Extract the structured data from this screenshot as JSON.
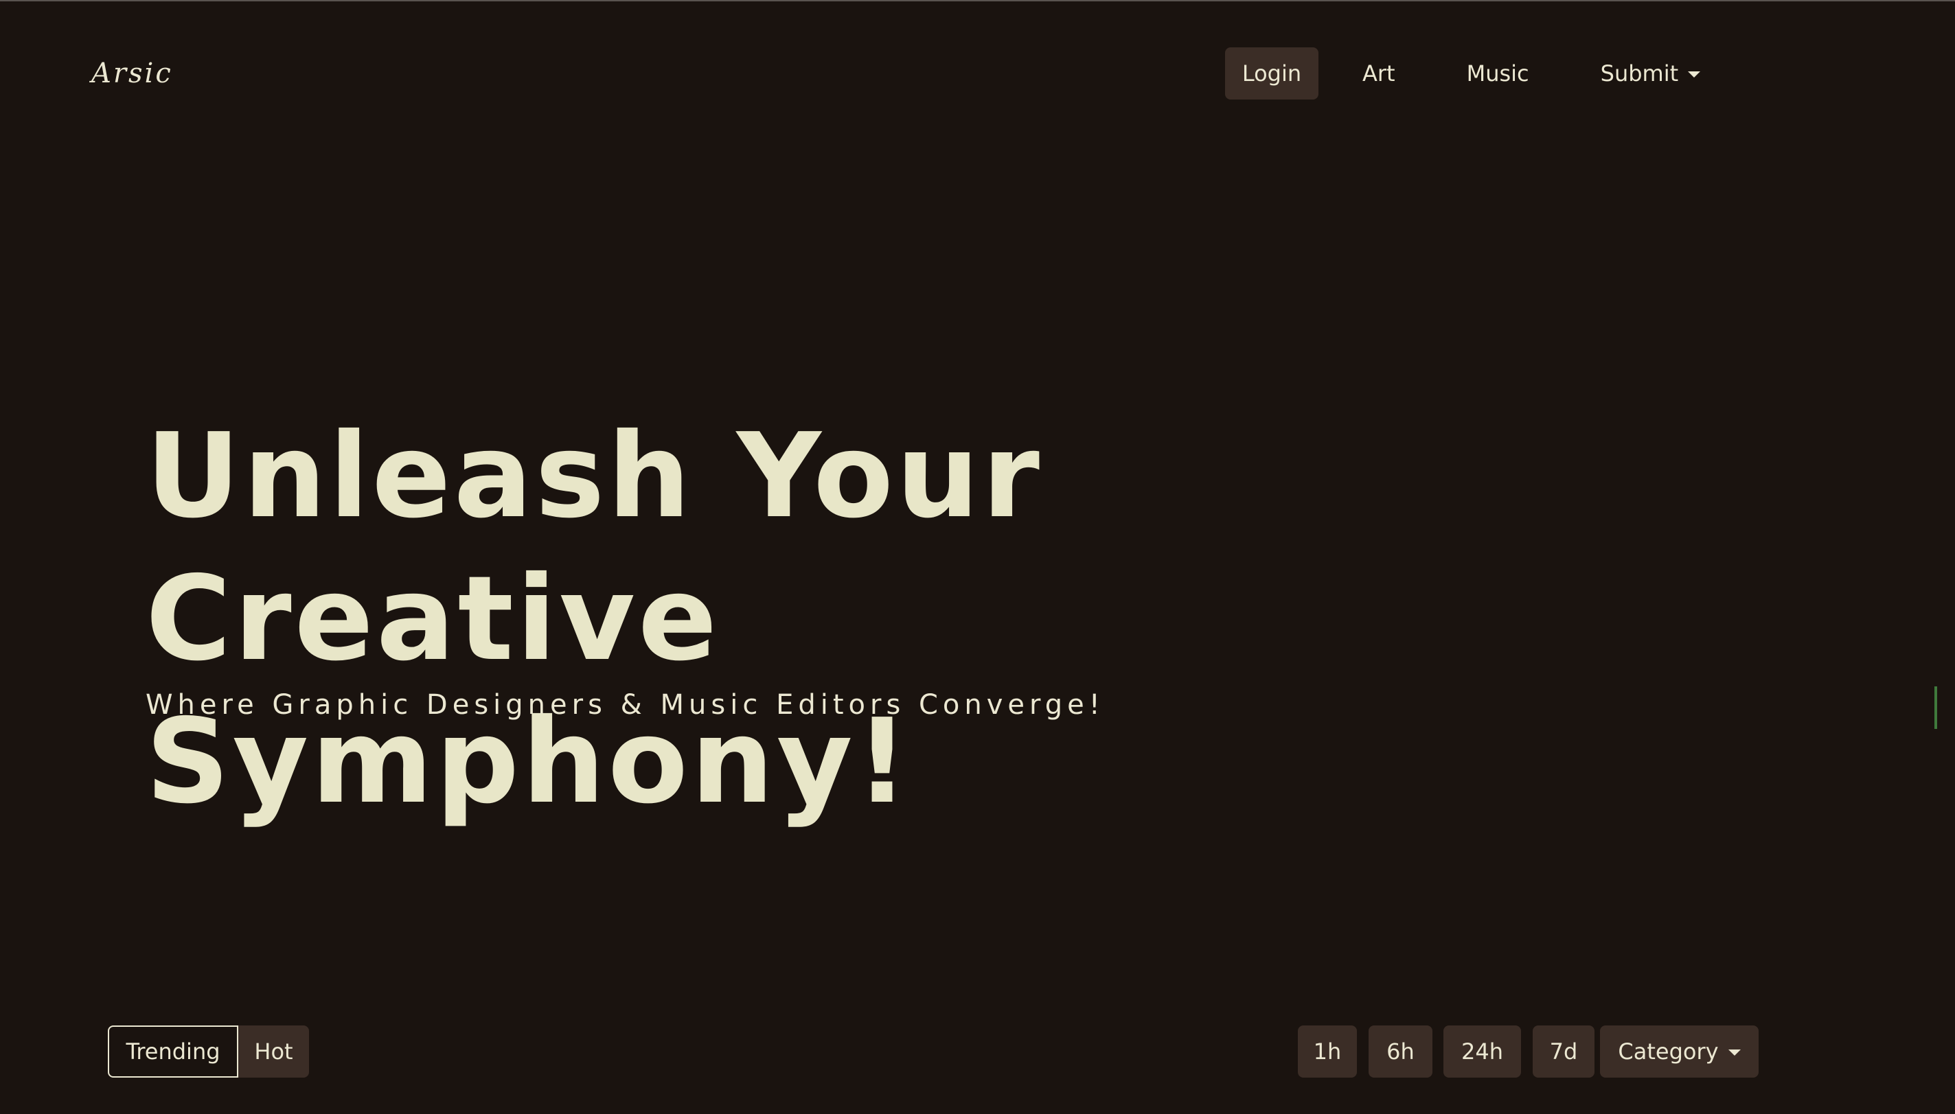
{
  "header": {
    "brand": "Arsic",
    "nav": {
      "login": "Login",
      "art": "Art",
      "music": "Music",
      "submit": "Submit"
    }
  },
  "hero": {
    "title_line1": "Unleash Your Creative",
    "title_line2": "Symphony!",
    "subtitle": "Where Graphic Designers & Music Editors Converge!"
  },
  "sort": {
    "options": [
      "Trending",
      "Hot"
    ],
    "selected": "Trending"
  },
  "filters": {
    "time_ranges": [
      "1h",
      "6h",
      "24h",
      "7d"
    ],
    "category_label": "Category"
  },
  "colors": {
    "background": "#1a130f",
    "text": "#ece8d2",
    "button_bg": "#3b2d26",
    "indicator": "#3f7a3c"
  },
  "icons": {
    "submit_dropdown": "caret-down-icon",
    "category_dropdown": "caret-down-icon"
  }
}
